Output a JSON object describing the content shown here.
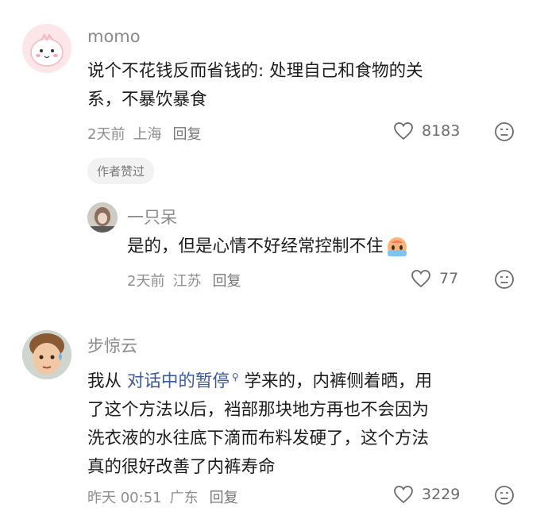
{
  "comments": [
    {
      "username": "momo",
      "text_lines": [
        "说个不花钱反而省钱的: 处理自己和食物的关",
        "系，不暴饮暴食"
      ],
      "time": "2天前",
      "location": "上海",
      "reply_label": "回复",
      "likes": "8183",
      "badge": "作者赞过",
      "avatar_icon": "pink-cartoon-avatar",
      "replies": [
        {
          "username": "一只呆",
          "text": "是的，但是心情不好经常控制不住",
          "emoji_icon": "crying-face-emoji",
          "time": "2天前",
          "location": "江苏",
          "reply_label": "回复",
          "likes": "77",
          "avatar_icon": "photo-avatar"
        }
      ]
    },
    {
      "username": "步惊云",
      "text_line1_prefix": "我从 ",
      "text_link": "对话中的暂停",
      "text_line1_suffix": " 学来的，内裤侧着晒，用",
      "text_lines_rest": [
        "了这个方法以后，裆部那块地方再也不会因为",
        "洗衣液的水往底下滴而布料发硬了，这个方法",
        "真的很好改善了内裤寿命"
      ],
      "time": "昨天 00:51",
      "location": "广东",
      "reply_label": "回复",
      "likes": "3229",
      "avatar_icon": "child-face-avatar"
    }
  ],
  "colors": {
    "link": "#3a5a9a",
    "meta": "#8e8e8e"
  }
}
